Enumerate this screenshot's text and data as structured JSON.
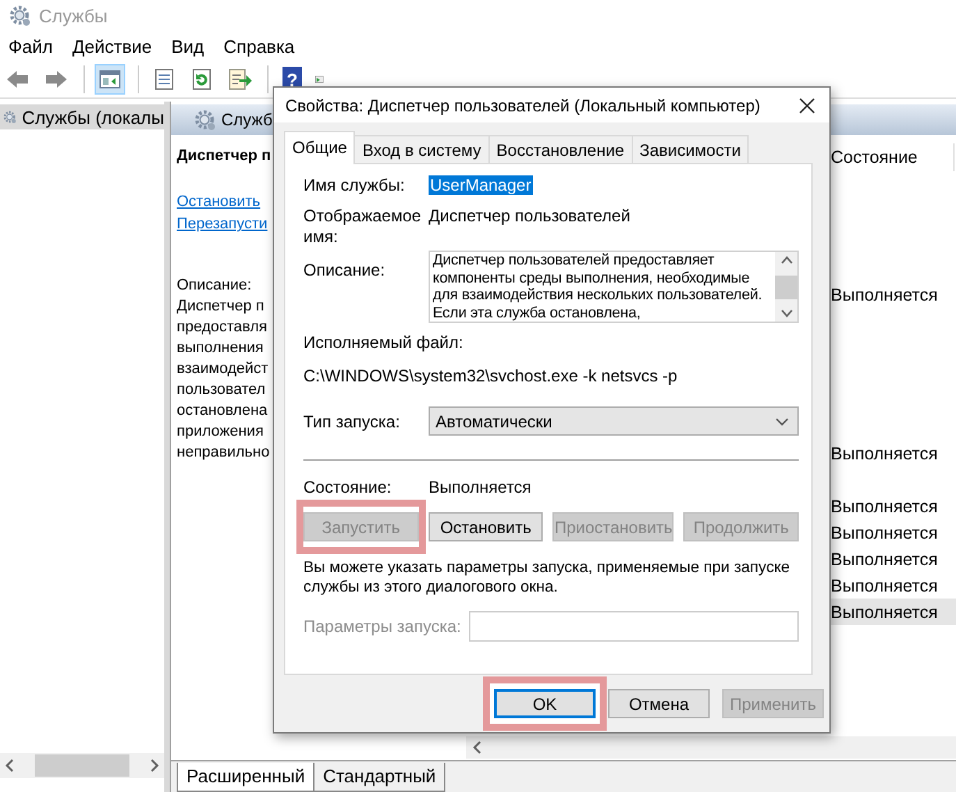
{
  "window": {
    "title": "Службы"
  },
  "menu": [
    "Файл",
    "Действие",
    "Вид",
    "Справка"
  ],
  "toolbar": [
    [
      {
        "kind": "back",
        "selected": false
      },
      {
        "kind": "forward",
        "selected": false
      }
    ],
    [
      {
        "kind": "tree",
        "selected": true
      }
    ],
    [
      {
        "kind": "properties",
        "selected": false
      },
      {
        "kind": "refresh",
        "selected": false
      },
      {
        "kind": "export",
        "selected": false
      }
    ],
    [
      {
        "kind": "help",
        "glyph": "?",
        "selected": false
      },
      {
        "kind": "run",
        "selected": false
      }
    ]
  ],
  "tree": {
    "items": [
      {
        "label": "Службы (локалы",
        "selected": true
      }
    ]
  },
  "pane": {
    "title": "Служб",
    "service_name": "Диспетчер п",
    "links": [
      "Остановить",
      "Перезапусти"
    ],
    "description_label": "Описание:",
    "description_lines": [
      "Диспетчер п",
      "предоставля",
      "выполнения",
      "взаимодейст",
      "пользовател",
      "остановлена",
      "приложения",
      "неправильно"
    ]
  },
  "list": {
    "columns": [
      "Состояние"
    ],
    "rows": [
      {
        "selected": false
      },
      {
        "selected": false
      },
      {
        "selected": false
      },
      {
        "selected": false
      },
      {
        "status": "Выполняется",
        "selected": false
      },
      {
        "selected": false
      },
      {
        "selected": false
      },
      {
        "selected": false
      },
      {
        "selected": false
      },
      {
        "selected": false
      },
      {
        "status": "Выполняется",
        "selected": false
      },
      {
        "selected": false
      },
      {
        "status": "Выполняется",
        "selected": false
      },
      {
        "status": "Выполняется",
        "selected": false
      },
      {
        "status": "Выполняется",
        "selected": false
      },
      {
        "status": "Выполняется",
        "selected": false
      },
      {
        "status": "Выполняется",
        "selected": true
      }
    ]
  },
  "view_tabs": [
    {
      "label": "Расширенный",
      "selected": true
    },
    {
      "label": "Стандартный",
      "selected": false
    }
  ],
  "dialog": {
    "title": "Свойства: Диспетчер пользователей (Локальный компьютер)",
    "tabs": [
      {
        "label": "Общие",
        "selected": true
      },
      {
        "label": "Вход в систему",
        "selected": false
      },
      {
        "label": "Восстановление",
        "selected": false
      },
      {
        "label": "Зависимости",
        "selected": false
      }
    ],
    "service_name_label": "Имя службы:",
    "service_name": "UserManager",
    "service_name_selected": true,
    "display_name_label": "Отображаемое имя:",
    "display_name": "Диспетчер пользователей",
    "description_label": "Описание:",
    "description": "Диспетчер пользователей предоставляет компоненты среды выполнения, необходимые для взаимодействия нескольких пользователей. Если эта служба остановлена,",
    "executable_label": "Исполняемый файл:",
    "executable": "C:\\WINDOWS\\system32\\svchost.exe -k netsvcs -p",
    "startup_type_label": "Тип запуска:",
    "startup_type": "Автоматически",
    "status_label": "Состояние:",
    "status": "Выполняется",
    "service_buttons": [
      {
        "label": "Запустить",
        "disabled": true,
        "highlighted": true
      },
      {
        "label": "Остановить",
        "disabled": false,
        "highlighted": false
      },
      {
        "label": "Приостановить",
        "disabled": true,
        "highlighted": false
      },
      {
        "label": "Продолжить",
        "disabled": true,
        "highlighted": false
      }
    ],
    "hint": "Вы можете указать параметры запуска, применяемые при запуске службы из этого диалогового окна.",
    "params": {
      "label": "Параметры запуска:",
      "disabled": true
    },
    "buttons": [
      {
        "label": "OK",
        "disabled": false,
        "focused": true,
        "highlighted": true
      },
      {
        "label": "Отмена",
        "disabled": false,
        "focused": false,
        "highlighted": false
      },
      {
        "label": "Применить",
        "disabled": true,
        "focused": false,
        "highlighted": false
      }
    ]
  }
}
